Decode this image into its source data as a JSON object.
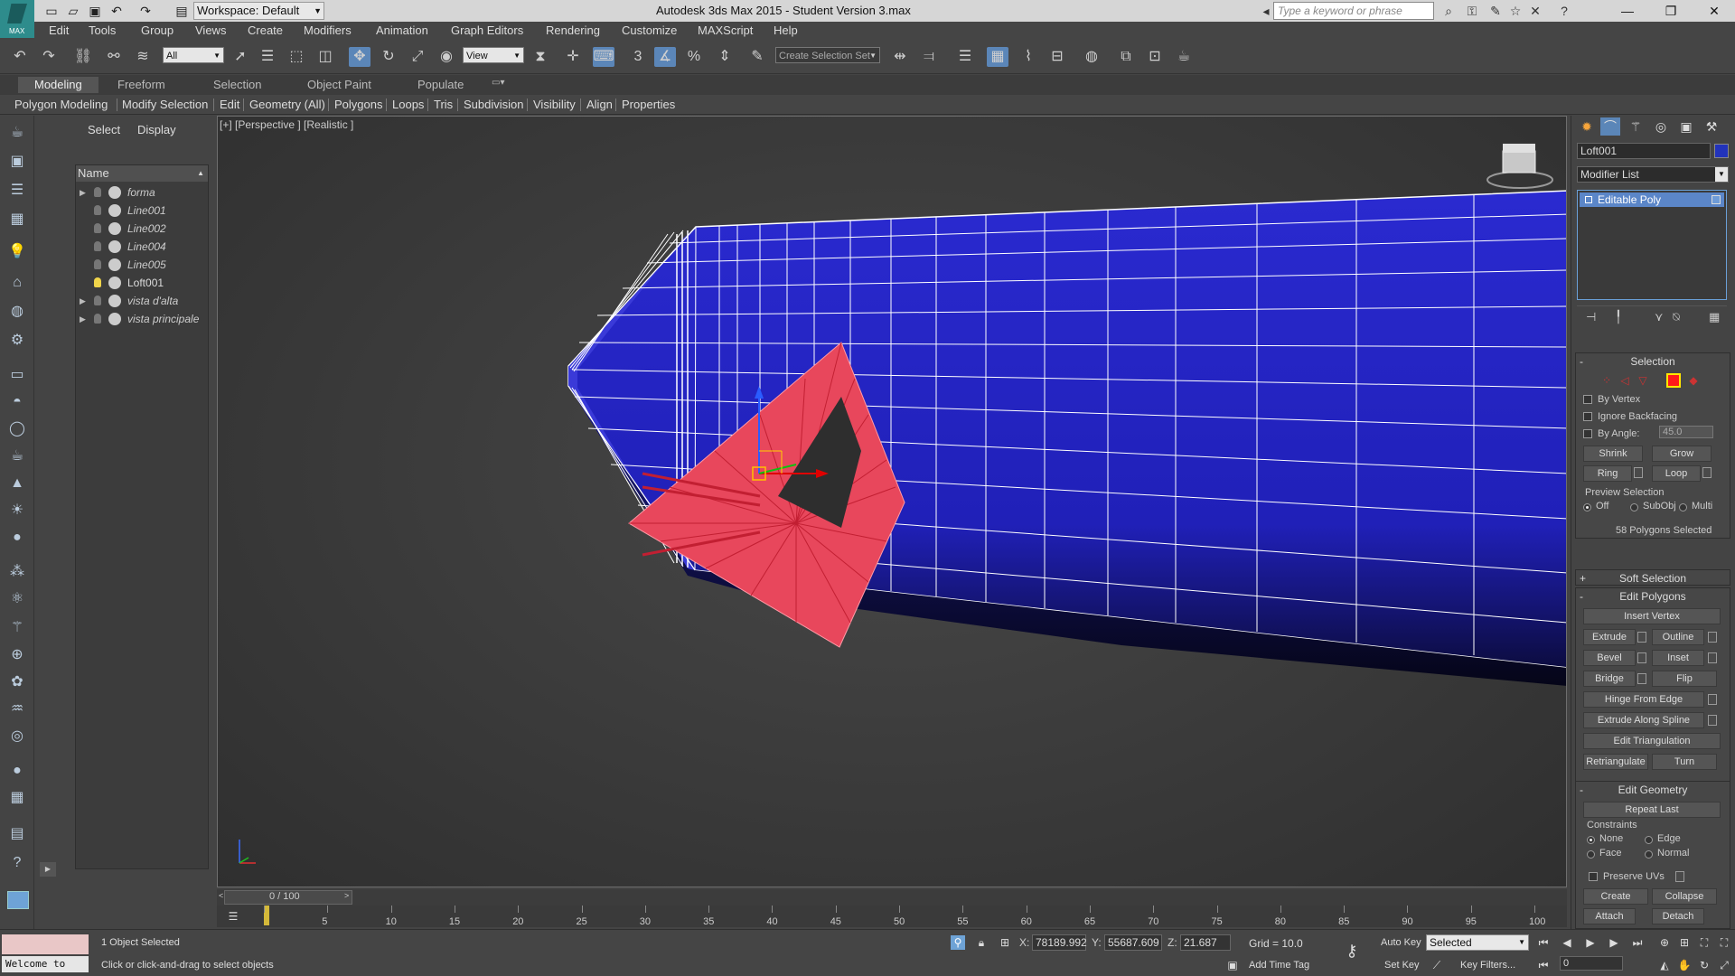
{
  "titlebar": {
    "logo_label": "MAX",
    "workspace": "Workspace: Default",
    "title": "Autodesk 3ds Max  2015   - Student Version      3.max",
    "search_placeholder": "Type a keyword or phrase"
  },
  "menu": [
    "Edit",
    "Tools",
    "Group",
    "Views",
    "Create",
    "Modifiers",
    "Animation",
    "Graph Editors",
    "Rendering",
    "Customize",
    "MAXScript",
    "Help"
  ],
  "maintoolbar": {
    "filter": "All",
    "refcoord": "View",
    "snap_3": "3",
    "selection_set_placeholder": "Create Selection Set"
  },
  "ribbon": {
    "tabs": [
      "Modeling",
      "Freeform",
      "Selection",
      "Object Paint",
      "Populate"
    ],
    "active_tab": "Modeling",
    "bar": [
      "Polygon Modeling",
      "Modify Selection",
      "Edit",
      "Geometry (All)",
      "Polygons",
      "Loops",
      "Tris",
      "Subdivision",
      "Visibility",
      "Align",
      "Properties"
    ]
  },
  "explorer": {
    "tabs": [
      "Select",
      "Display"
    ],
    "column": "Name",
    "items": [
      {
        "name": "forma",
        "expand": true,
        "italic": true,
        "light": false
      },
      {
        "name": "Line001",
        "expand": false,
        "italic": true,
        "light": false
      },
      {
        "name": "Line002",
        "expand": false,
        "italic": true,
        "light": false
      },
      {
        "name": "Line004",
        "expand": false,
        "italic": true,
        "light": false
      },
      {
        "name": "Line005",
        "expand": false,
        "italic": true,
        "light": false
      },
      {
        "name": "Loft001",
        "expand": false,
        "italic": false,
        "light": true
      },
      {
        "name": "vista d'alta",
        "expand": true,
        "italic": true,
        "light": false
      },
      {
        "name": "vista principale",
        "expand": true,
        "italic": true,
        "light": false
      }
    ]
  },
  "viewport": {
    "label": "[+] [Perspective ] [Realistic ]"
  },
  "cmdpanel": {
    "object_name": "Loft001",
    "object_color": "#2233bb",
    "modifier_list": "Modifier List",
    "stack": [
      "Editable Poly"
    ],
    "selection": {
      "title": "Selection",
      "by_vertex": "By Vertex",
      "ignore_backfacing": "Ignore Backfacing",
      "by_angle": "By Angle:",
      "angle_value": "45.0",
      "shrink": "Shrink",
      "grow": "Grow",
      "ring": "Ring",
      "loop": "Loop",
      "preview_title": "Preview Selection",
      "preview_off": "Off",
      "preview_subobj": "SubObj",
      "preview_multi": "Multi",
      "status": "58 Polygons Selected"
    },
    "soft_selection": "Soft Selection",
    "edit_polygons": {
      "title": "Edit Polygons",
      "insert_vertex": "Insert Vertex",
      "extrude": "Extrude",
      "outline": "Outline",
      "bevel": "Bevel",
      "inset": "Inset",
      "bridge": "Bridge",
      "flip": "Flip",
      "hinge": "Hinge From Edge",
      "extrude_spline": "Extrude Along Spline",
      "edit_tri": "Edit Triangulation",
      "retriangulate": "Retriangulate",
      "turn": "Turn"
    },
    "edit_geometry": {
      "title": "Edit Geometry",
      "repeat_last": "Repeat Last",
      "constraints": "Constraints",
      "none": "None",
      "edge": "Edge",
      "face": "Face",
      "normal": "Normal",
      "preserve_uvs": "Preserve UVs",
      "create": "Create",
      "collapse": "Collapse",
      "attach": "Attach",
      "detach": "Detach"
    }
  },
  "timeline": {
    "frame": "0 / 100",
    "ticks": [
      "5",
      "10",
      "15",
      "20",
      "25",
      "30",
      "35",
      "40",
      "45",
      "50",
      "55",
      "60",
      "65",
      "70",
      "75",
      "80",
      "85",
      "90",
      "95",
      "100"
    ]
  },
  "status": {
    "welcome": "Welcome to MAX",
    "selected_count": "1 Object Selected",
    "prompt": "Click or click-and-drag to select objects",
    "x_label": "X:",
    "x": "78189.992",
    "y_label": "Y:",
    "y": "55687.609",
    "z_label": "Z:",
    "z": "21.687",
    "grid": "Grid = 10.0",
    "add_time_tag": "Add Time Tag",
    "auto_key": "Auto Key",
    "set_key": "Set Key",
    "selected_mode": "Selected",
    "key_filters": "Key Filters...",
    "frame_value": "0"
  }
}
